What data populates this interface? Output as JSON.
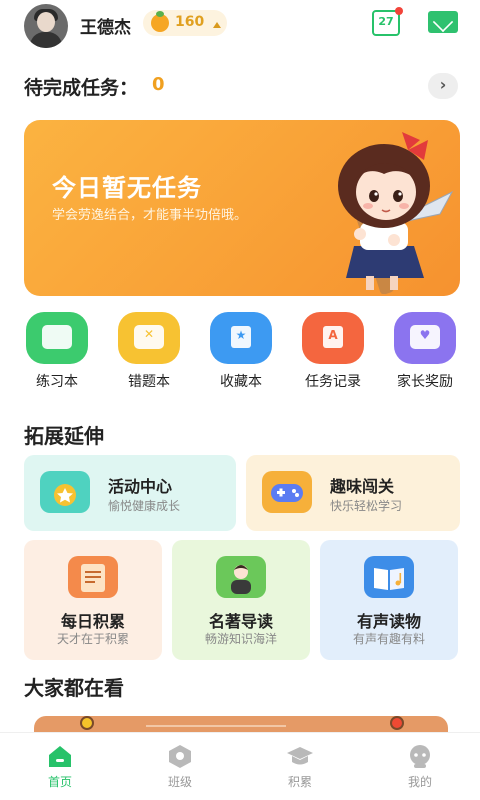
{
  "header": {
    "username": "王德杰",
    "coins": "160",
    "calendar_date": "27"
  },
  "pending": {
    "label": "待完成任务：",
    "count": "0"
  },
  "banner": {
    "title": "今日暂无任务",
    "subtitle": "学会劳逸结合，才能事半功倍哦。"
  },
  "quick_actions": [
    {
      "label": "练习本",
      "color": "#3ccb6e"
    },
    {
      "label": "错题本",
      "color": "#f7c232"
    },
    {
      "label": "收藏本",
      "color": "#3d9af2"
    },
    {
      "label": "任务记录",
      "color": "#f4663f"
    },
    {
      "label": "家长奖励",
      "color": "#8b74ef"
    }
  ],
  "extend": {
    "title": "拓展延伸",
    "wide_cards": [
      {
        "title": "活动中心",
        "subtitle": "愉悦健康成长",
        "bg": "#dff6f2",
        "icon_color": "#4fd2c0"
      },
      {
        "title": "趣味闯关",
        "subtitle": "快乐轻松学习",
        "bg": "#fdf1da",
        "icon_color": "#f6b03a"
      }
    ],
    "tall_cards": [
      {
        "title": "每日积累",
        "subtitle": "天才在于积累",
        "bg": "#fdeee3",
        "icon_color": "#f48a4b"
      },
      {
        "title": "名著导读",
        "subtitle": "畅游知识海洋",
        "bg": "#e9f7dc",
        "icon_color": "#6bc85a"
      },
      {
        "title": "有声读物",
        "subtitle": "有声有趣有料",
        "bg": "#e2eefb",
        "icon_color": "#3d8de8"
      }
    ]
  },
  "popular": {
    "title": "大家都在看"
  },
  "tabbar": {
    "tabs": [
      {
        "label": "首页",
        "active": true
      },
      {
        "label": "班级",
        "active": false
      },
      {
        "label": "积累",
        "active": false
      },
      {
        "label": "我的",
        "active": false
      }
    ],
    "active_color": "#27c26a"
  }
}
